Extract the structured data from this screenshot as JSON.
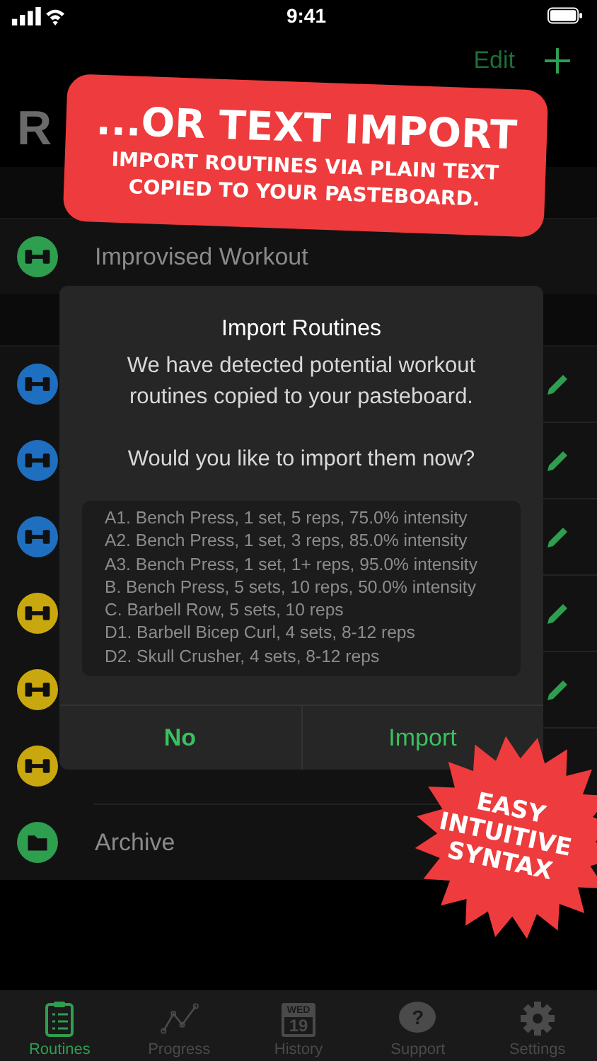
{
  "status_bar": {
    "time": "9:41"
  },
  "nav": {
    "edit": "Edit",
    "title": "R"
  },
  "sections": [
    {
      "items": [
        {
          "kind": "routine",
          "color": "#2e9e4f",
          "label": "Improvised Workout",
          "editable": false
        }
      ]
    },
    {
      "items": [
        {
          "kind": "routine",
          "color": "#1f6fc0",
          "editable": true
        },
        {
          "kind": "routine",
          "color": "#1f6fc0",
          "editable": true
        },
        {
          "kind": "routine",
          "color": "#1f6fc0",
          "editable": true
        },
        {
          "kind": "routine",
          "color": "#c9a80f",
          "editable": true
        },
        {
          "kind": "routine",
          "color": "#c9a80f",
          "editable": true
        },
        {
          "kind": "routine",
          "color": "#c9a80f",
          "editable": false
        },
        {
          "kind": "folder",
          "color": "#2e9e4f",
          "label": "Archive",
          "editable": false
        }
      ]
    }
  ],
  "banner": {
    "headline": "...OR TEXT IMPORT",
    "lines": [
      "IMPORT ROUTINES VIA PLAIN TEXT",
      "COPIED TO YOUR PASTEBOARD."
    ]
  },
  "dialog": {
    "title": "Import Routines",
    "message": "We have detected potential workout routines copied to your pasteboard.",
    "question": "Would you like to import them now?",
    "import_text": [
      "A1. Bench Press, 1 set, 5 reps, 75.0% intensity",
      "A2. Bench Press, 1 set, 3 reps, 85.0% intensity",
      "A3. Bench Press, 1 set, 1+ reps, 95.0% intensity",
      "B. Bench Press, 5 sets, 10 reps, 50.0% intensity",
      "C. Barbell Row, 5 sets, 10 reps",
      "D1. Barbell Bicep Curl, 4 sets, 8-12 reps",
      "D2. Skull Crusher, 4 sets, 8-12 reps"
    ],
    "buttons": [
      {
        "label": "No",
        "bold": true
      },
      {
        "label": "Import",
        "bold": false
      }
    ]
  },
  "burst": {
    "lines": [
      "EASY",
      "INTUITIVE",
      "SYNTAX"
    ]
  },
  "tabs": [
    {
      "kind": "clipboard",
      "label": "Routines",
      "selected": true
    },
    {
      "kind": "chart",
      "label": "Progress",
      "selected": false
    },
    {
      "kind": "calendar",
      "label": "History",
      "selected": false,
      "weekday": "WED",
      "day": "19"
    },
    {
      "kind": "help",
      "label": "Support",
      "selected": false,
      "glyph": "?"
    },
    {
      "kind": "gear",
      "label": "Settings",
      "selected": false
    }
  ]
}
